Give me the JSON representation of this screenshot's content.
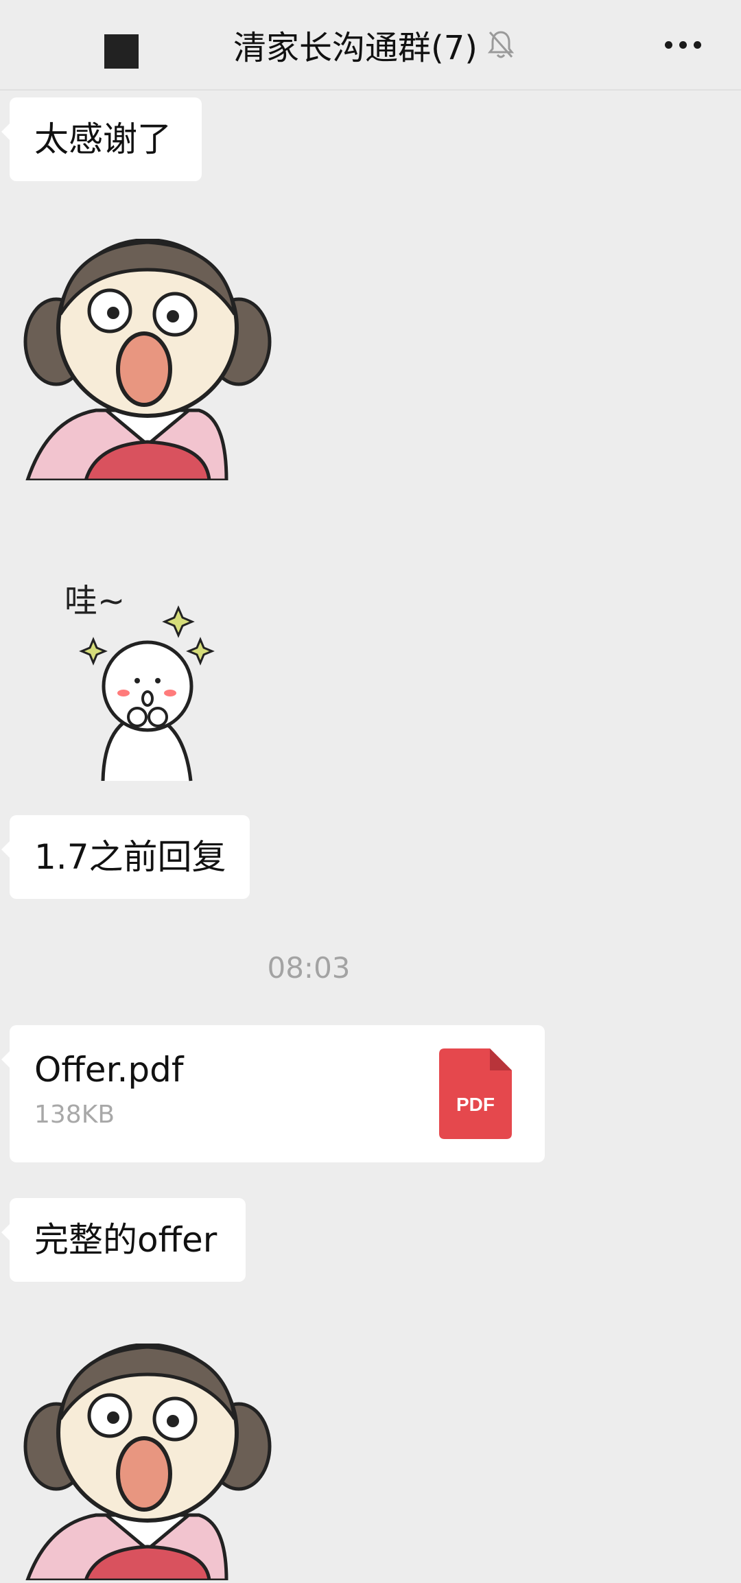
{
  "header": {
    "title": "清家长沟通群(7)",
    "back_icon": "back-icon",
    "mute_icon": "bell-muted-icon",
    "more_icon": "more-icon"
  },
  "messages": [
    {
      "type": "text",
      "text": "太感谢了"
    },
    {
      "type": "sticker",
      "sticker": "shocked-girl-sticker"
    },
    {
      "type": "sticker",
      "sticker": "wow-sticker",
      "caption": "哇~"
    },
    {
      "type": "text",
      "text": "1.7之前回复"
    },
    {
      "type": "timestamp",
      "text": "08:03"
    },
    {
      "type": "file",
      "name": "Offer.pdf",
      "size": "138KB",
      "badge": "PDF"
    },
    {
      "type": "text",
      "text": "完整的offer"
    },
    {
      "type": "sticker",
      "sticker": "shocked-girl-sticker"
    }
  ],
  "colors": {
    "background": "#ededed",
    "bubble": "#ffffff",
    "pdf_icon": "#e5484d",
    "timestamp": "#a3a3a3"
  }
}
